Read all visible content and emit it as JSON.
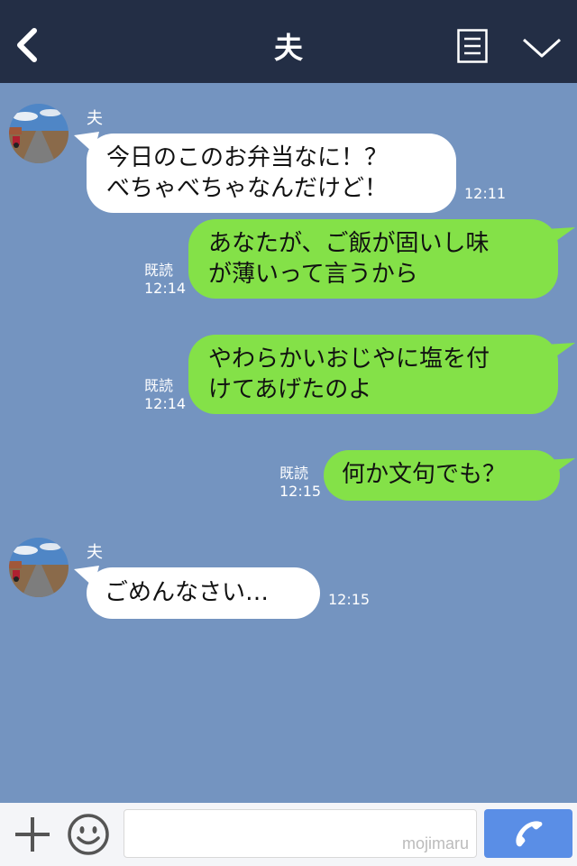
{
  "header": {
    "title": "夫",
    "back_icon": "chevron-left-icon",
    "notes_icon": "notes-icon",
    "menu_icon": "chevron-down-icon"
  },
  "messages": [
    {
      "side": "left",
      "sender": "夫",
      "text": "今日のこのお弁当なに！？\nべちゃべちゃなんだけど！",
      "time": "12:11"
    },
    {
      "side": "right",
      "read": "既読",
      "time": "12:14",
      "text": "あなたが、ご飯が固いし味\nが薄いって言うから"
    },
    {
      "side": "right",
      "read": "既読",
      "time": "12:14",
      "text": "やわらかいおじやに塩を付\nけてあげたのよ"
    },
    {
      "side": "right",
      "read": "既読",
      "time": "12:15",
      "text": "何か文句でも？"
    },
    {
      "side": "left",
      "sender": "夫",
      "text": "ごめんなさい…",
      "time": "12:15"
    }
  ],
  "input_bar": {
    "plus_icon": "plus-icon",
    "emoji_icon": "emoji-icon",
    "message_value": "",
    "watermark": "mojimaru",
    "call_icon": "phone-icon"
  },
  "colors": {
    "header_bg": "#232e45",
    "chat_bg": "#7494c0",
    "bubble_green": "#84e148",
    "bubble_white": "#ffffff",
    "call_button": "#5a8ee6"
  }
}
